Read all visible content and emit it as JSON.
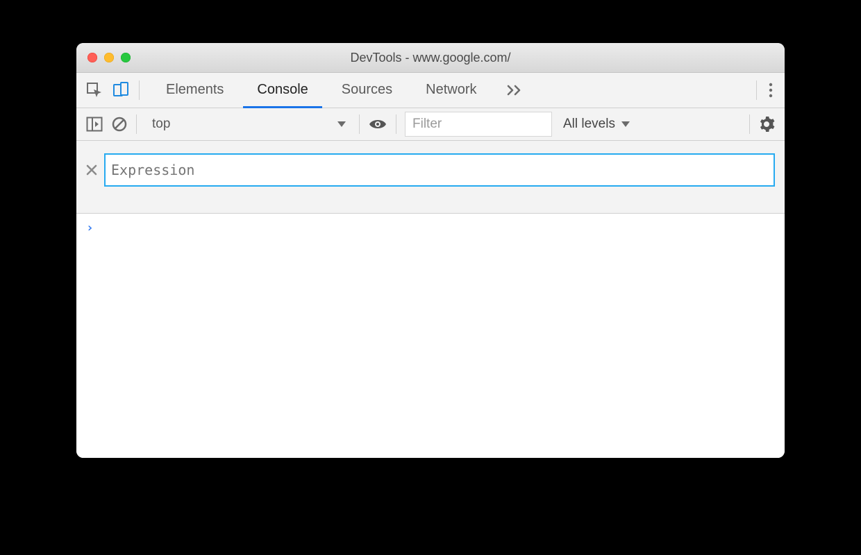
{
  "window": {
    "title": "DevTools - www.google.com/"
  },
  "tabs": {
    "items": [
      "Elements",
      "Console",
      "Sources",
      "Network"
    ],
    "active": "Console"
  },
  "console_toolbar": {
    "context_selected": "top",
    "filter_placeholder": "Filter",
    "levels_label": "All levels"
  },
  "live_expression": {
    "placeholder": "Expression",
    "value": ""
  },
  "prompt": {
    "symbol": "›"
  }
}
